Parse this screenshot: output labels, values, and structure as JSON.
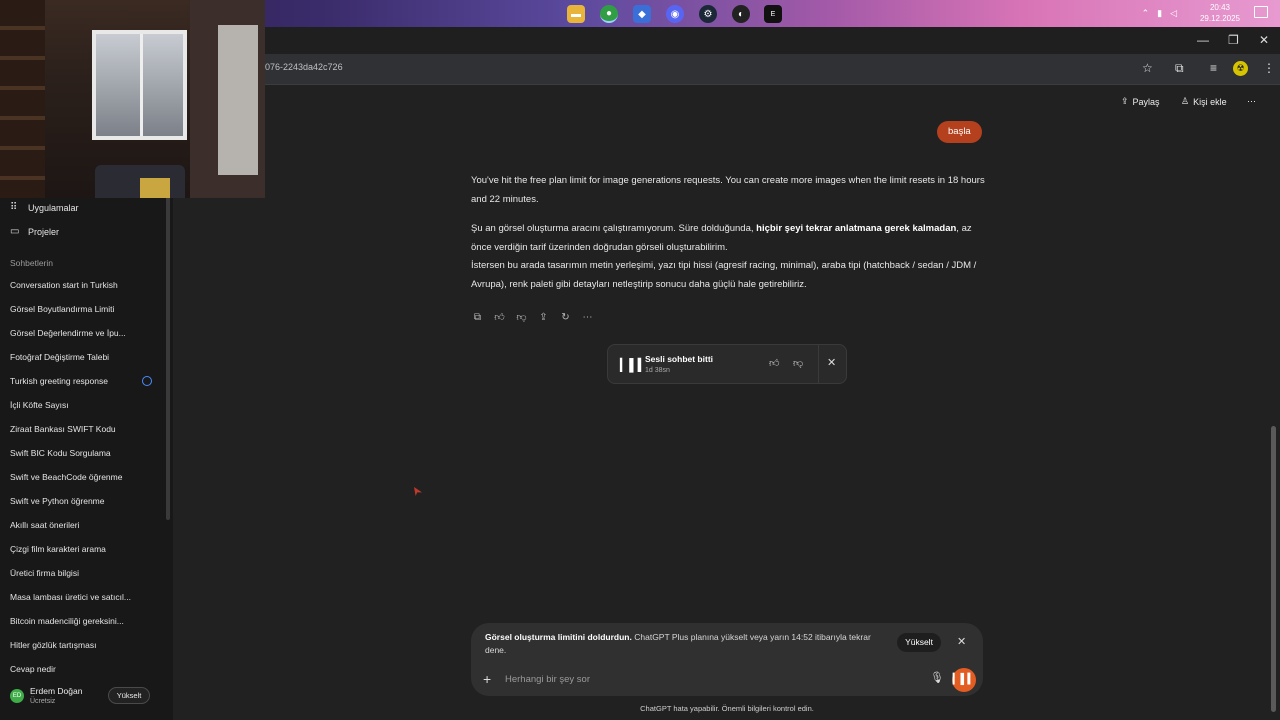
{
  "taskbar": {
    "clock_time": "20:43",
    "clock_date": "29.12.2025",
    "icons": [
      "file-explorer-icon",
      "chrome-icon",
      "app-icon",
      "discord-icon",
      "steam-icon",
      "game-icon",
      "epic-games-icon"
    ]
  },
  "browser": {
    "url": "076-2243da42c726"
  },
  "header": {
    "share_label": "Paylaş",
    "add_person_label": "Kişi ekle"
  },
  "sidebar": {
    "apps_label": "Uygulamalar",
    "projects_label": "Projeler",
    "section_label": "Sohbetlerin",
    "chats": [
      "Conversation start in Turkish",
      "Görsel Boyutlandırma Limiti",
      "Görsel Değerlendirme ve İpu...",
      "Fotoğraf Değiştirme Talebi",
      "Turkish greeting response",
      "İçli Köfte Sayısı",
      "Ziraat Bankası SWIFT Kodu",
      "Swift BIC Kodu Sorgulama",
      "Swift ve BeachCode öğrenme",
      "Swift ve Python öğrenme",
      "Akıllı saat önerileri",
      "Çizgi film karakteri arama",
      "Üretici firma bilgisi",
      "Masa lambası üretici ve satıcıl...",
      "Bitcoin madenciliği gereksini...",
      "Hitler gözlük tartışması",
      "Cevap nedir"
    ],
    "user": {
      "initials": "ED",
      "name": "Erdem Doğan",
      "plan": "Ücretsiz",
      "upgrade_label": "Yükselt"
    }
  },
  "chat": {
    "user_message": "başla",
    "assistant_p1": "You've hit the free plan limit for image generations requests. You can create more images when the limit resets in 18 hours and 22 minutes.",
    "assistant_p2_a": "Şu an görsel oluşturma aracını çalıştıramıyorum. Süre dolduğunda, ",
    "assistant_p2_bold": "hiçbir şeyi tekrar anlatmana gerek kalmadan",
    "assistant_p2_b": ", az önce verdiğin tarif üzerinden doğrudan görseli oluşturabilirim.",
    "assistant_p3": "İstersen bu arada tasarımın metin yerleşimi, yazı tipi hissi (agresif racing, minimal), araba tipi (hatchback / sedan / JDM / Avrupa), renk paleti gibi detayları netleştirip sonucu daha güçlü hale getirebiliriz.",
    "voice_card": {
      "title": "Sesli sohbet bitti",
      "duration": "1d 38sn"
    }
  },
  "composer": {
    "limit_bold": "Görsel oluşturma limitini doldurdun.",
    "limit_text": " ChatGPT Plus planına yükselt veya yarın 14:52 itibarıyla tekrar dene.",
    "upgrade_label": "Yükselt",
    "placeholder": "Herhangi bir şey sor",
    "disclaimer": "ChatGPT hata yapabilir. Önemli bilgileri kontrol edin."
  },
  "colors": {
    "user_bubble": "#b5401d",
    "voice_button": "#e35d23",
    "background": "#212121",
    "sidebar": "#181818"
  }
}
